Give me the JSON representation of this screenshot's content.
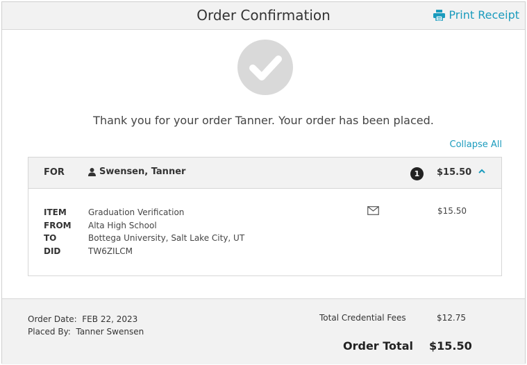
{
  "header": {
    "title": "Order Confirmation",
    "print_label": "Print Receipt"
  },
  "message": "Thank you for your order Tanner. Your order has been placed.",
  "collapse_label": "Collapse All",
  "order": {
    "for_label": "FOR",
    "recipient": "Swensen, Tanner",
    "item_count": "1",
    "price": "$15.50",
    "item": {
      "labels": [
        "ITEM",
        "FROM",
        "TO",
        "DID"
      ],
      "values": [
        "Graduation Verification",
        "Alta High School",
        "Bottega University, Salt Lake City, UT",
        "TW6ZILCM"
      ],
      "price": "$15.50"
    }
  },
  "footer": {
    "order_date_label": "Order Date:",
    "order_date": "FEB 22, 2023",
    "placed_by_label": "Placed By:",
    "placed_by": "Tanner Swensen",
    "fees_label": "Total Credential Fees",
    "fees_value": "$12.75",
    "total_label": "Order Total",
    "total_value": "$15.50"
  },
  "colors": {
    "accent": "#1a9bbd",
    "header_bg": "#f2f2f2",
    "badge": "#222222",
    "check_circle": "#d9d9d9"
  },
  "icons": {
    "print": "printer-icon",
    "person": "person-icon",
    "mail": "envelope-icon",
    "chevron": "chevron-up-icon",
    "success": "checkmark-icon"
  }
}
